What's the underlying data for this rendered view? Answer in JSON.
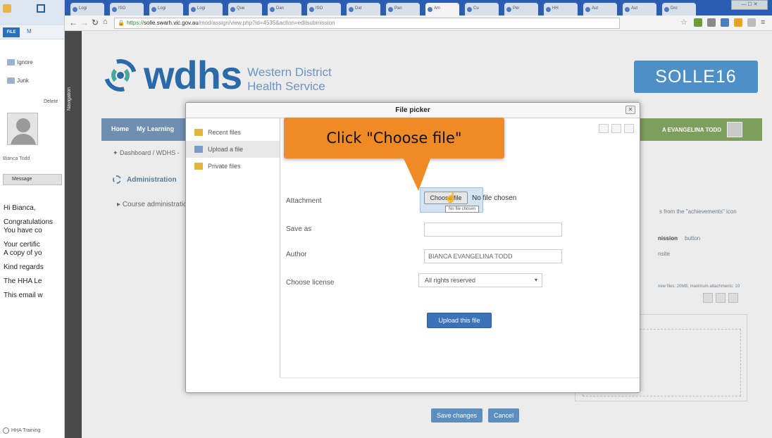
{
  "outlook": {
    "file_tab": "FILE",
    "ribbon_tab": "M",
    "ignore_label": "Ignore",
    "junk_label": "Junk",
    "delete_label": "Delete",
    "sender": "Bianca Todd",
    "message_button": "Message",
    "body_lines": [
      "Hi Bianca,",
      "Congratulations",
      "You have co",
      "Your certific",
      "A copy of yo",
      "Kind regards",
      "The HHA Le",
      "This email w"
    ],
    "footer_label": "HHA Training"
  },
  "browser": {
    "tabs": [
      "Logi",
      "ISO",
      "Logi",
      "Logi",
      "Que",
      "Dan",
      "ISO",
      "Dat",
      "Pan",
      "Am",
      "Cu",
      "Per",
      "HH",
      "Aut",
      "Aut",
      "Dro"
    ],
    "active_tab_index": 9,
    "url_scheme": "https://",
    "url_host": "solle.swarh.vic.gov.au",
    "url_path": "/mod/assign/view.php?id=4535&action=editsubmission",
    "window_controls": "— ☐ ✕"
  },
  "nav_strip_label": "Navigation",
  "site": {
    "logo_word": "wdhs",
    "logo_sub_line1": "Western District",
    "logo_sub_line2": "Health Service",
    "badge": "SOLLE16",
    "nav_home": "Home",
    "nav_my_learning": "My Learning",
    "user_name": "A EVANGELINA TODD",
    "breadcrumb": "Dashboard / WDHS -",
    "admin_title": "Administration",
    "admin_item": "Course administration",
    "right_text_1": "s from the \"achievements\" icon",
    "right_text_2": "nission",
    "right_text_3": "button",
    "right_text_4": "nsite",
    "right_text_5": "new files: 20MB, maximum attachments: 10",
    "save_button": "Save changes",
    "cancel_button": "Cancel"
  },
  "file_picker": {
    "title": "File picker",
    "repositories": [
      "Recent files",
      "Upload a file",
      "Private files"
    ],
    "active_repository_index": 1,
    "attachment_label": "Attachment",
    "choose_file_button": "Choose file",
    "no_file_text": "No file chosen",
    "tooltip": "No file chosen",
    "save_as_label": "Save as",
    "save_as_value": "",
    "author_label": "Author",
    "author_value": "BIANCA EVANGELINA TODD",
    "license_label": "Choose license",
    "license_value": "All rights reserved",
    "upload_button": "Upload this file"
  },
  "callout": {
    "text": "Click \"Choose file\""
  },
  "colors": {
    "callout": "#f08a24",
    "brand_blue": "#2b6aa8",
    "navbar": "#6e8fb0",
    "primary_button": "#3b72b8"
  }
}
